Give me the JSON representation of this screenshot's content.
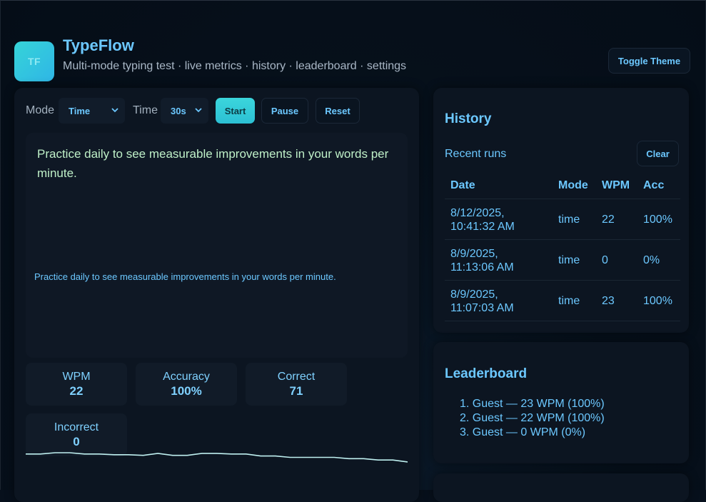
{
  "header": {
    "logo_text": "TF",
    "title": "TypeFlow",
    "subtitle": "Multi-mode typing test · live metrics · history · leaderboard · settings",
    "toggle_theme_label": "Toggle Theme"
  },
  "controls": {
    "mode_label": "Mode",
    "mode_value": "Time",
    "time_label": "Time",
    "time_value": "30s",
    "start_label": "Start",
    "pause_label": "Pause",
    "reset_label": "Reset"
  },
  "test": {
    "passage": "Practice daily to see measurable improvements in your words per minute.",
    "typed": "Practice daily to see measurable improvements in your words per minute."
  },
  "stats": {
    "wpm_label": "WPM",
    "wpm_value": "22",
    "accuracy_label": "Accuracy",
    "accuracy_value": "100%",
    "correct_label": "Correct",
    "correct_value": "71",
    "incorrect_label": "Incorrect",
    "incorrect_value": "0"
  },
  "chart_data": {
    "type": "line",
    "title": "",
    "xlabel": "",
    "ylabel": "",
    "grid": false,
    "color": "#bff0f0",
    "values": [
      24,
      24,
      26,
      26,
      24,
      24,
      23,
      23,
      22,
      25,
      22,
      22,
      25,
      25,
      24,
      24,
      21,
      21,
      19,
      19,
      19,
      19,
      17,
      17,
      15,
      15,
      12
    ]
  },
  "history": {
    "title": "History",
    "subtitle": "Recent runs",
    "clear_label": "Clear",
    "columns": [
      "Date",
      "Mode",
      "WPM",
      "Acc"
    ],
    "rows": [
      {
        "date_line1": "8/12/2025,",
        "date_line2": "10:41:32 AM",
        "mode": "time",
        "wpm": "22",
        "acc": "100%"
      },
      {
        "date_line1": "8/9/2025,",
        "date_line2": "11:13:06 AM",
        "mode": "time",
        "wpm": "0",
        "acc": "0%"
      },
      {
        "date_line1": "8/9/2025,",
        "date_line2": "11:07:03 AM",
        "mode": "time",
        "wpm": "23",
        "acc": "100%"
      }
    ]
  },
  "leaderboard": {
    "title": "Leaderboard",
    "entries": [
      "1. Guest — 23 WPM (100%)",
      "2. Guest — 22 WPM (100%)",
      "3. Guest — 0 WPM (0%)"
    ]
  },
  "colors": {
    "accent": "#6cc8ff",
    "start_button": "#3bd6dc",
    "passage_text": "#bff0c8",
    "background": "#07101c"
  },
  "icons": {
    "select_chevron": "chevron-down-icon"
  }
}
